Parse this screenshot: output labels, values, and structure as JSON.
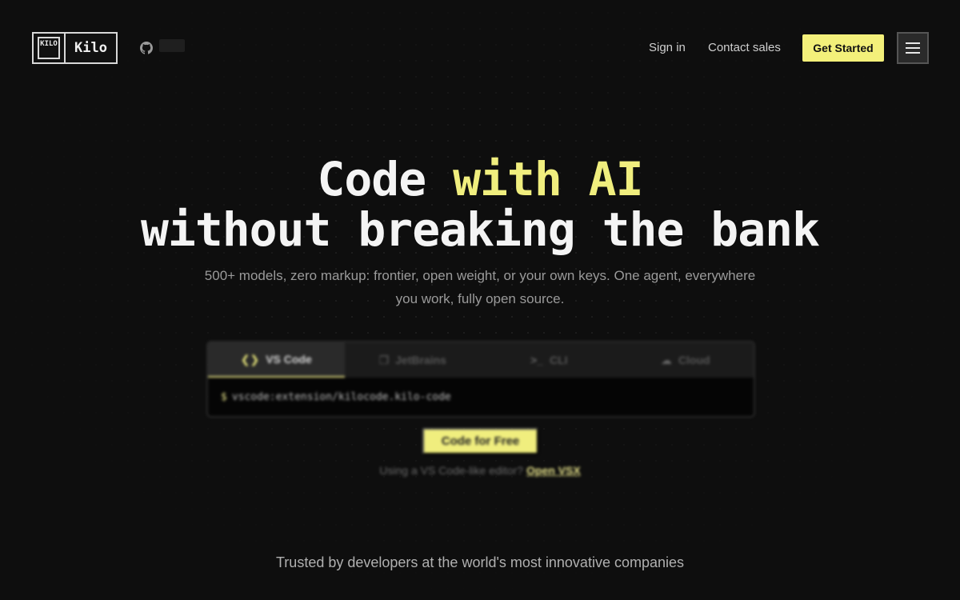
{
  "header": {
    "logo_mark": "KILO",
    "logo_text": "Kilo",
    "nav": {
      "signin": "Sign in",
      "contact": "Contact sales"
    },
    "cta": "Get Started"
  },
  "hero": {
    "line1_plain": "Code ",
    "line1_accent": "with AI",
    "line2": "without breaking the bank",
    "subtitle": "500+ models, zero markup: frontier, open weight, or your own keys. One agent, everywhere you work, fully open source."
  },
  "install": {
    "tabs": [
      {
        "label": "VS Code",
        "icon": "vscode-icon"
      },
      {
        "label": "JetBrains",
        "icon": "jetbrains-icon"
      },
      {
        "label": "CLI",
        "icon": "terminal-icon"
      },
      {
        "label": "Cloud",
        "icon": "cloud-icon"
      }
    ],
    "active_tab": "VS Code",
    "prompt": "$",
    "command": "vscode:extension/kilocode.kilo-code",
    "cta": "Code for Free",
    "alt_text": "Using a VS Code-like editor?",
    "alt_link": "Open VSX"
  },
  "trusted": "Trusted by developers at the world's most innovative companies",
  "colors": {
    "background": "#0e0e0e",
    "accent": "#f0ee7e",
    "text": "#f4f4f4"
  }
}
